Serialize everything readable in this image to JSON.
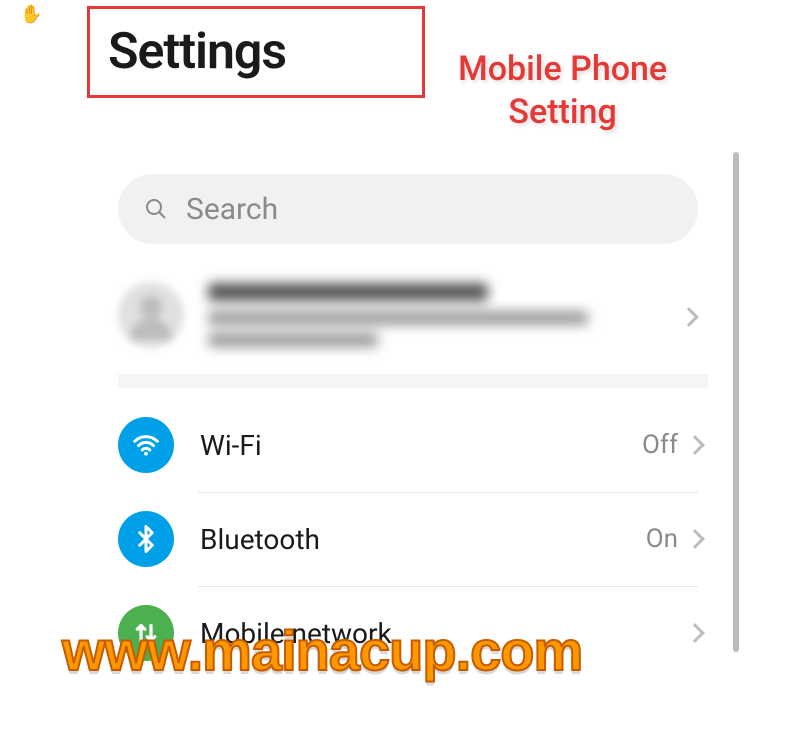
{
  "cursor_glyph": "✋",
  "title": "Settings",
  "annotation_line1": "Mobile Phone",
  "annotation_line2": "Setting",
  "search": {
    "placeholder": "Search"
  },
  "rows": {
    "wifi": {
      "label": "Wi-Fi",
      "value": "Off",
      "color": "#00a0e9"
    },
    "bluetooth": {
      "label": "Bluetooth",
      "value": "On",
      "color": "#00a0e9"
    },
    "mobile": {
      "label": "Mobile network",
      "value": "",
      "color": "#4caf50"
    }
  },
  "watermark": "www.mainacup.com"
}
